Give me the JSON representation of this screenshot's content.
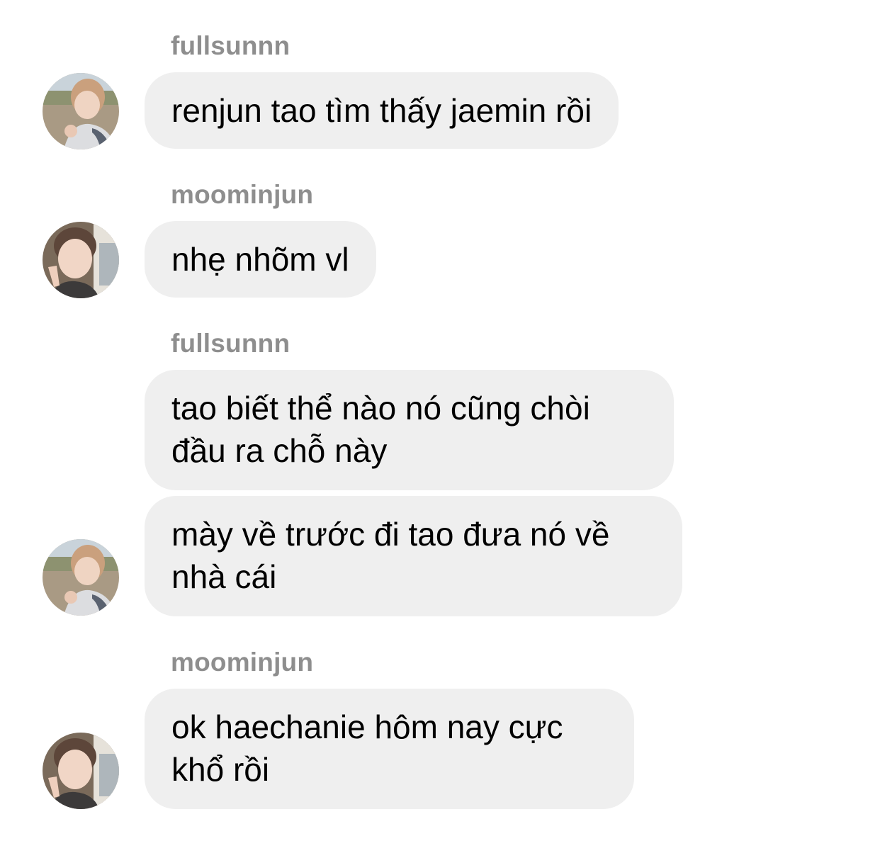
{
  "conversation": {
    "groups": [
      {
        "sender": "fullsunnn",
        "messages": [
          "renjun tao tìm thấy jaemin rồi"
        ],
        "avatar_icon": "profile-photo-fullsunnn"
      },
      {
        "sender": "moominjun",
        "messages": [
          "nhẹ nhõm vl"
        ],
        "avatar_icon": "profile-photo-moominjun"
      },
      {
        "sender": "fullsunnn",
        "messages": [
          "tao biết thể nào nó cũng chòi đầu ra chỗ này",
          "mày về trước đi tao đưa nó về nhà cái"
        ],
        "avatar_icon": "profile-photo-fullsunnn"
      },
      {
        "sender": "moominjun",
        "messages": [
          "ok haechanie hôm nay cực khổ rồi"
        ],
        "avatar_icon": "profile-photo-moominjun"
      }
    ]
  },
  "colors": {
    "bubble_background": "#efefef",
    "sender_name": "#8e8e8e",
    "message_text": "#000000"
  }
}
